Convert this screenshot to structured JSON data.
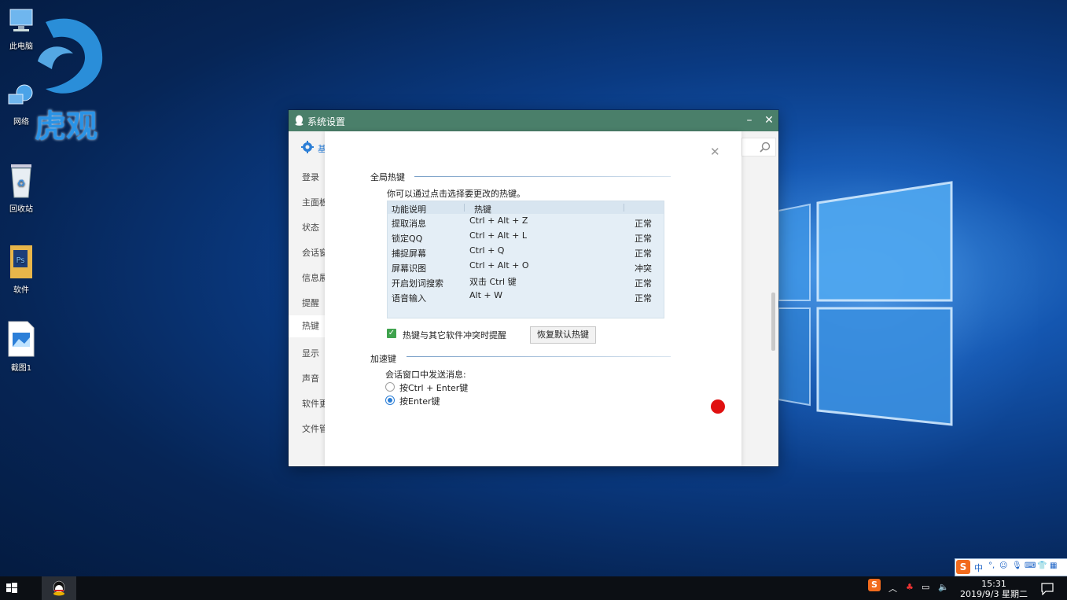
{
  "desktop": {
    "icons": [
      {
        "label": "此电脑",
        "icon": "computer-icon"
      },
      {
        "label": "网络",
        "icon": "network-icon"
      },
      {
        "label": "回收站",
        "icon": "recycle-bin-icon"
      },
      {
        "label": "软件",
        "icon": "photoshop-folder-icon"
      },
      {
        "label": "截图1",
        "icon": "image-file-icon"
      }
    ],
    "watermark": "虎观"
  },
  "window": {
    "title": "系统设置",
    "sidebar": {
      "header_icon": "gear-icon",
      "header_label": "基",
      "items": [
        {
          "label": "登录"
        },
        {
          "label": "主面板"
        },
        {
          "label": "状态"
        },
        {
          "label": "会话窗口"
        },
        {
          "label": "信息展示"
        },
        {
          "label": "提醒"
        },
        {
          "label": "热键"
        },
        {
          "label": "显示"
        },
        {
          "label": "声音"
        },
        {
          "label": "软件更新"
        },
        {
          "label": "文件管理"
        }
      ],
      "active": "热键"
    },
    "panel": {
      "global_hotkeys": {
        "title": "全局热键",
        "hint": "你可以通过点击选择要更改的热键。",
        "columns": [
          "功能说明",
          "热键",
          ""
        ],
        "rows": [
          {
            "name": "提取消息",
            "key": "Ctrl + Alt + Z",
            "status": "正常"
          },
          {
            "name": "锁定QQ",
            "key": "Ctrl + Alt + L",
            "status": "正常"
          },
          {
            "name": "捕捉屏幕",
            "key": "Ctrl + Q",
            "status": "正常"
          },
          {
            "name": "屏幕识图",
            "key": "Ctrl + Alt + O",
            "status": "冲突"
          },
          {
            "name": "开启划词搜索",
            "key": "双击 Ctrl 键",
            "status": "正常"
          },
          {
            "name": "语音输入",
            "key": "Alt + W",
            "status": "正常"
          }
        ],
        "conflict_checkbox_label": "热键与其它软件冲突时提醒",
        "conflict_checkbox_checked": true,
        "restore_button": "恢复默认热键"
      },
      "accelerator": {
        "title": "加速键",
        "send_label": "会话窗口中发送消息:",
        "options": [
          {
            "label": "按Ctrl + Enter键",
            "selected": false
          },
          {
            "label": "按Enter键",
            "selected": true
          }
        ]
      }
    }
  },
  "taskbar": {
    "time": "15:31",
    "date": "2019/9/3 星期二",
    "ime_lang": "中"
  },
  "colors": {
    "titlebar": "#4a7f6a",
    "accent": "#2b7ed6",
    "checkbox": "#3fa34d"
  }
}
